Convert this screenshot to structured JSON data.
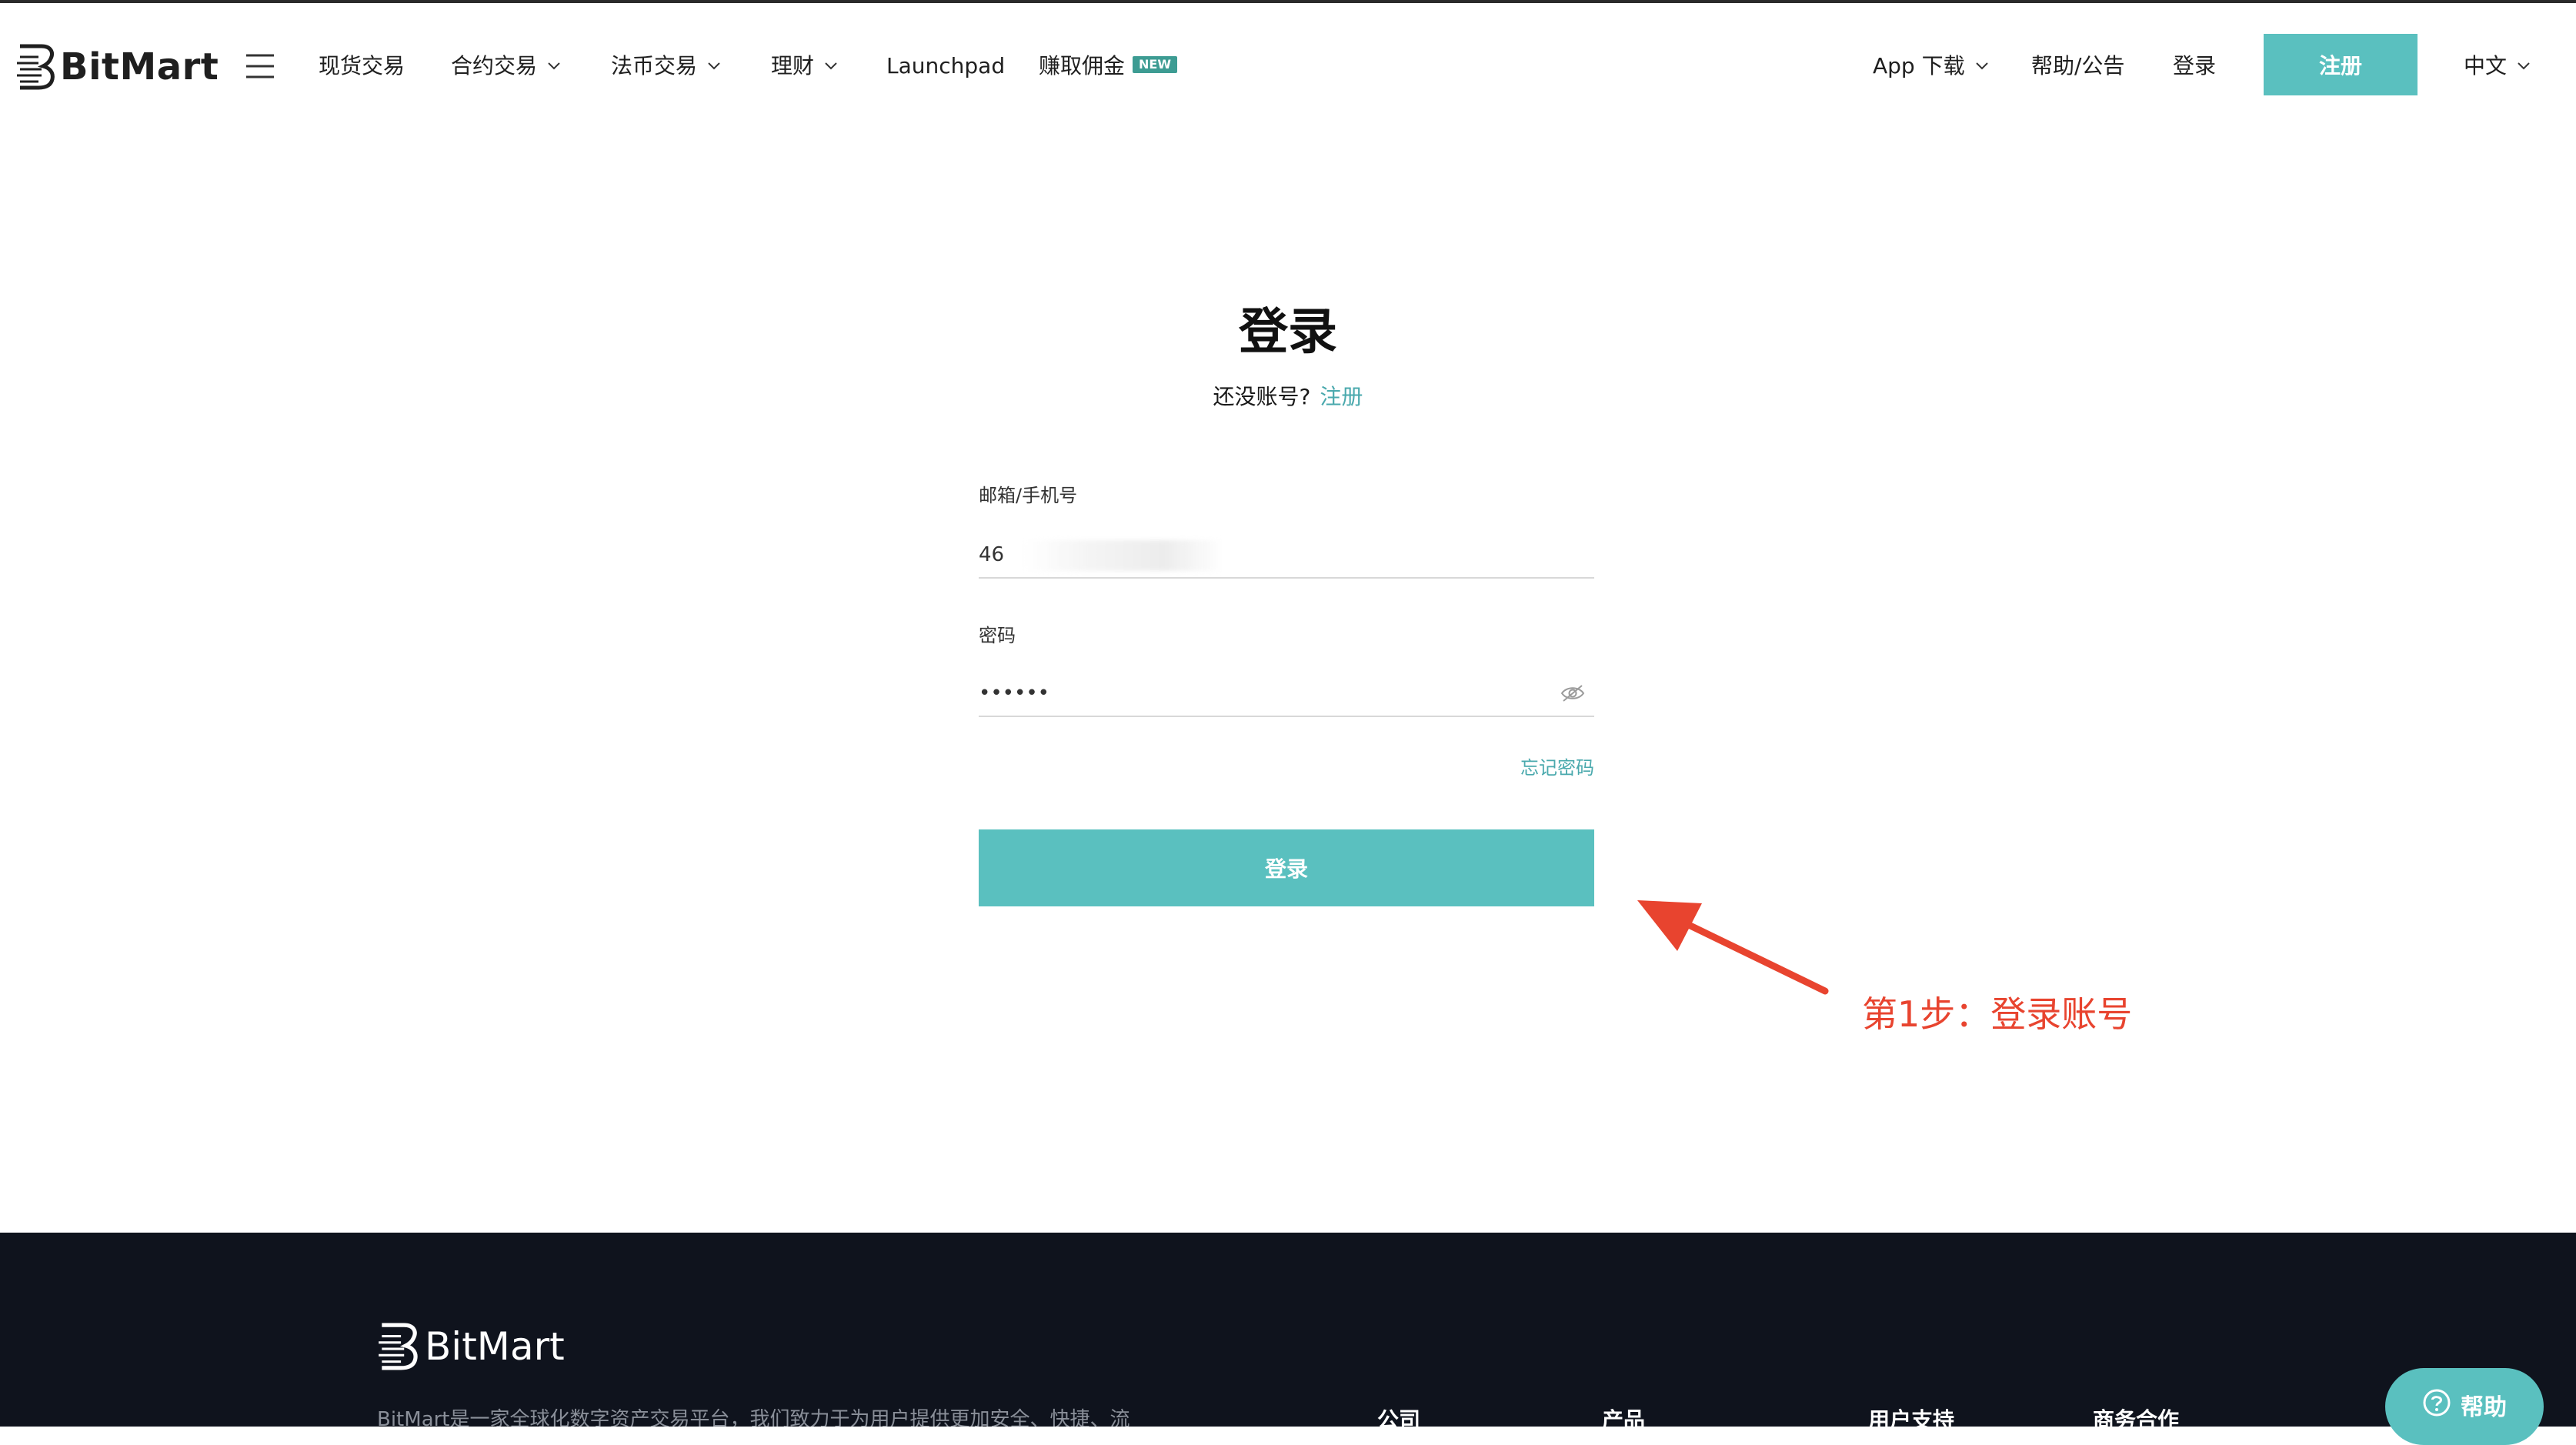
{
  "header": {
    "logo_text": "BitMart",
    "nav": [
      {
        "label": "现货交易"
      },
      {
        "label": "合约交易"
      },
      {
        "label": "法币交易"
      },
      {
        "label": "理财"
      },
      {
        "label": "Launchpad"
      },
      {
        "label": "赚取佣金",
        "badge": "NEW"
      }
    ],
    "right": {
      "app_download": "App 下载",
      "help": "帮助/公告",
      "login": "登录",
      "register": "注册",
      "language": "中文"
    }
  },
  "login": {
    "title": "登录",
    "no_account": "还没账号?",
    "register_link": "注册",
    "account_label": "邮箱/手机号",
    "account_value": "46",
    "password_label": "密码",
    "password_value": "••••••",
    "forgot": "忘记密码",
    "submit": "登录"
  },
  "annotation": {
    "text": "第1步：登录账号",
    "color": "#e8442f"
  },
  "footer": {
    "logo_text": "BitMart",
    "description": "BitMart是一家全球化数字资产交易平台，我们致力于为用户提供更加安全、快捷、流",
    "columns": [
      "公司",
      "产品",
      "用户支持",
      "商务合作"
    ],
    "help_button": "帮助"
  },
  "colors": {
    "accent": "#5ac0bf",
    "link": "#4aa9ad",
    "footer_bg": "#0f131d"
  }
}
